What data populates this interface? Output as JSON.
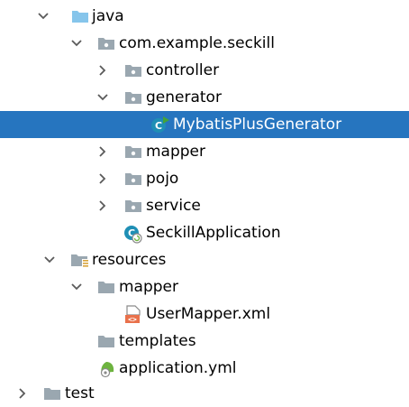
{
  "project_tree": {
    "nodes": [
      {
        "label": "java",
        "expanded": true,
        "icon": "source-folder-icon"
      },
      {
        "label": "com.example.seckill",
        "expanded": true,
        "icon": "package-icon"
      },
      {
        "label": "controller",
        "expanded": false,
        "icon": "package-icon"
      },
      {
        "label": "generator",
        "expanded": true,
        "icon": "package-icon"
      },
      {
        "label": "MybatisPlusGenerator",
        "selected": true,
        "icon": "java-class-icon"
      },
      {
        "label": "mapper",
        "expanded": false,
        "icon": "package-icon"
      },
      {
        "label": "pojo",
        "expanded": false,
        "icon": "package-icon"
      },
      {
        "label": "service",
        "expanded": false,
        "icon": "package-icon"
      },
      {
        "label": "SeckillApplication",
        "icon": "spring-boot-app-icon"
      },
      {
        "label": "resources",
        "expanded": true,
        "icon": "resources-folder-icon"
      },
      {
        "label": "mapper",
        "expanded": true,
        "icon": "folder-icon"
      },
      {
        "label": "UserMapper.xml",
        "icon": "xml-file-icon"
      },
      {
        "label": "templates",
        "icon": "folder-icon"
      },
      {
        "label": "application.yml",
        "icon": "spring-config-icon"
      },
      {
        "label": "test",
        "expanded": false,
        "icon": "folder-icon"
      }
    ]
  },
  "colors": {
    "selection_background": "#2675bf",
    "selection_text": "#ffffff",
    "text": "#000000",
    "folder_gray": "#9aa7b0",
    "source_folder_blue": "#86c5eb",
    "class_icon_teal": "#1f8fb5",
    "run_arrow_green": "#45a33a",
    "xml_orange": "#e9714b",
    "spring_green": "#6db33f"
  }
}
